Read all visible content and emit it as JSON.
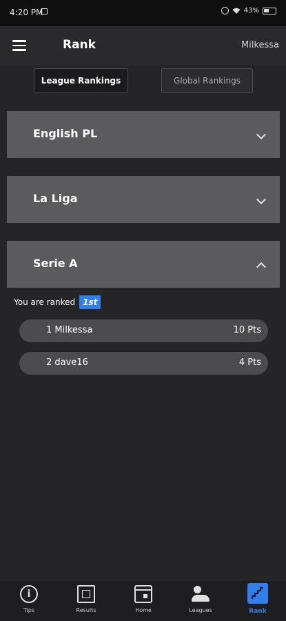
{
  "status_bar": {
    "time": "4:20 PM",
    "battery": "43%"
  },
  "app_bar": {
    "title": "Rank",
    "username": "Milkessa",
    "menu_icon": "menu-icon"
  },
  "tabs": {
    "league": "League Rankings",
    "global": "Global Rankings",
    "selected": "League Rankings"
  },
  "leagues": [
    {
      "name": "English PL",
      "expanded": false,
      "icon": "chevron-down-icon"
    },
    {
      "name": "La Liga",
      "expanded": false,
      "icon": "chevron-down-icon"
    },
    {
      "name": "Serie A",
      "expanded": true,
      "icon": "chevron-up-icon"
    }
  ],
  "serie_a": {
    "rank_text": "You are ranked",
    "rank_badge": "1st",
    "rows": [
      {
        "player": "1 Milkessa",
        "points": "10 Pts"
      },
      {
        "player": "2 dave16",
        "points": "4 Pts"
      }
    ]
  },
  "bottom_nav": {
    "items": [
      {
        "label": "Tips",
        "icon": "info-icon"
      },
      {
        "label": "Results",
        "icon": "results-icon"
      },
      {
        "label": "Home",
        "icon": "calendar-icon"
      },
      {
        "label": "Leagues",
        "icon": "people-icon"
      },
      {
        "label": "Rank",
        "icon": "stairs-icon",
        "active": true
      }
    ]
  },
  "colors": {
    "accent": "#2f80ed",
    "background": "#252527",
    "card": "#5b5b5d",
    "row": "#4c4c4e"
  }
}
